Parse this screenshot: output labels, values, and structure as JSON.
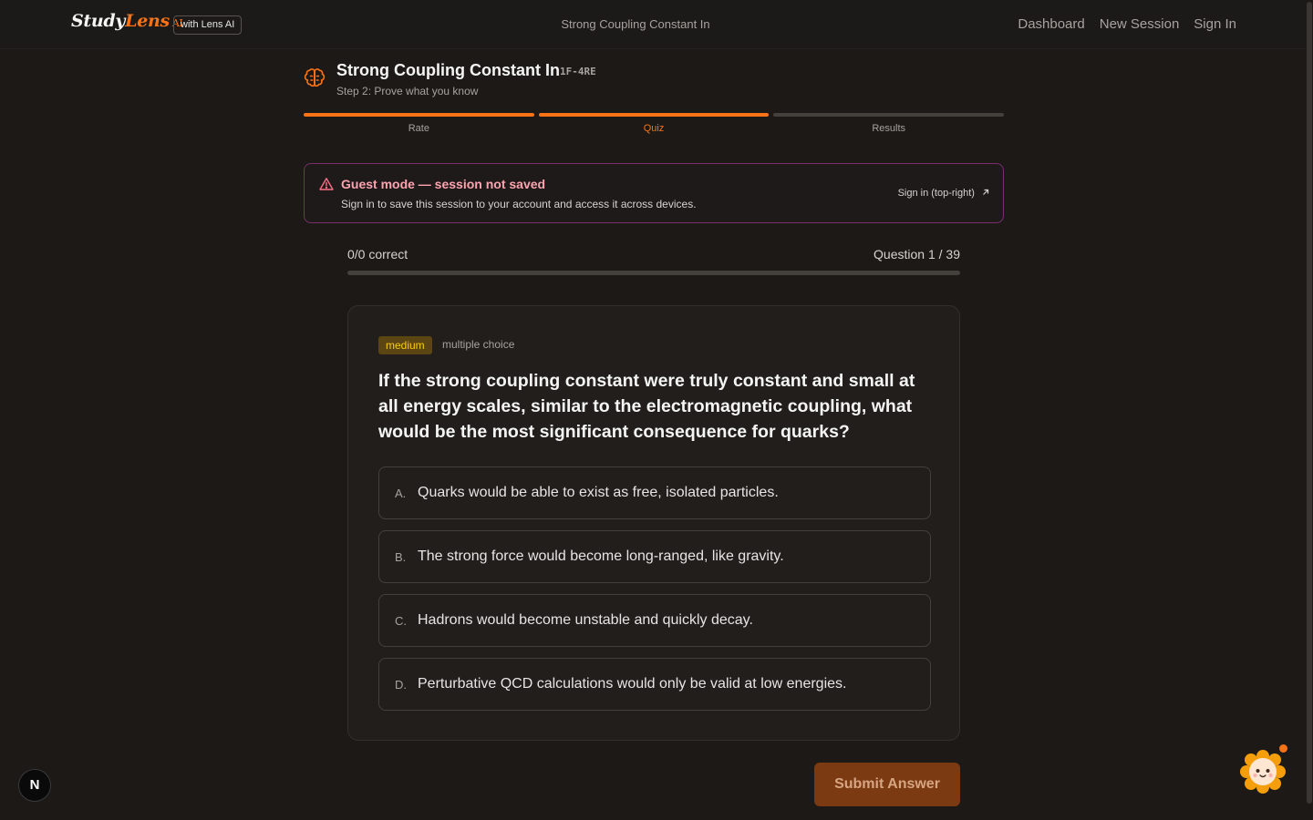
{
  "header": {
    "logo_study": "Study",
    "logo_lens": "Lens",
    "logo_ai": "AI",
    "badge": "with Lens AI",
    "center_title": "Strong Coupling Constant In",
    "nav": [
      "Dashboard",
      "New Session",
      "Sign In"
    ]
  },
  "session": {
    "title": "Strong Coupling Constant In",
    "code": "1F-4RE",
    "step_subtitle": "Step 2: Prove what you know",
    "steps": [
      {
        "label": "Rate",
        "done": true
      },
      {
        "label": "Quiz",
        "done": true,
        "current": true
      },
      {
        "label": "Results",
        "done": false
      }
    ]
  },
  "banner": {
    "title": "Guest mode — session not saved",
    "text": "Sign in to save this session to your account and access it across devices.",
    "link": "Sign in (top-right)",
    "link_icon": "arrow-up-right-icon"
  },
  "progress": {
    "score": "0/0 correct",
    "question_count": "Question 1 / 39",
    "fraction": 0.0
  },
  "question": {
    "difficulty": "medium",
    "type": "multiple choice",
    "text": "If the strong coupling constant were truly constant and small at all energy scales, similar to the electromagnetic coupling, what would be the most significant consequence for quarks?",
    "options": [
      {
        "letter": "A.",
        "text": "Quarks would be able to exist as free, isolated particles."
      },
      {
        "letter": "B.",
        "text": "The strong force would become long-ranged, like gravity."
      },
      {
        "letter": "C.",
        "text": "Hadrons would become unstable and quickly decay."
      },
      {
        "letter": "D.",
        "text": "Perturbative QCD calculations would only be valid at low energies."
      }
    ]
  },
  "submit_label": "Submit Answer",
  "dev_badge": "N",
  "colors": {
    "accent": "#f97316",
    "background": "#1c1917",
    "banner_border": "#7a2f6b",
    "difficulty_badge": "#5b4512"
  }
}
